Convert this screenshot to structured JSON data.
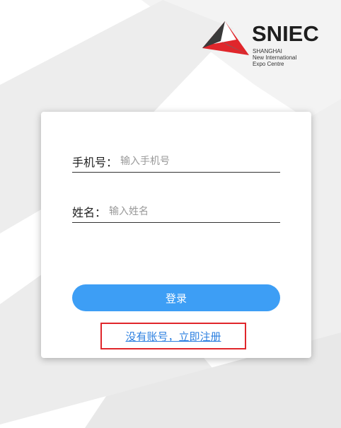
{
  "logo": {
    "name": "SNIEC",
    "sub_lines": [
      "SHANGHAI",
      "New International",
      "Expo Centre"
    ],
    "colors": {
      "red": "#e0262b",
      "dark": "#333333"
    }
  },
  "form": {
    "phone": {
      "label": "手机号：",
      "placeholder": "输入手机号"
    },
    "name": {
      "label": "姓名：",
      "placeholder": "输入姓名"
    },
    "login_label": "登录",
    "register_link": "没有账号，立即注册"
  },
  "colors": {
    "button": "#3d9ef5",
    "link": "#2b7fe0",
    "highlight_border": "#e0262b"
  }
}
